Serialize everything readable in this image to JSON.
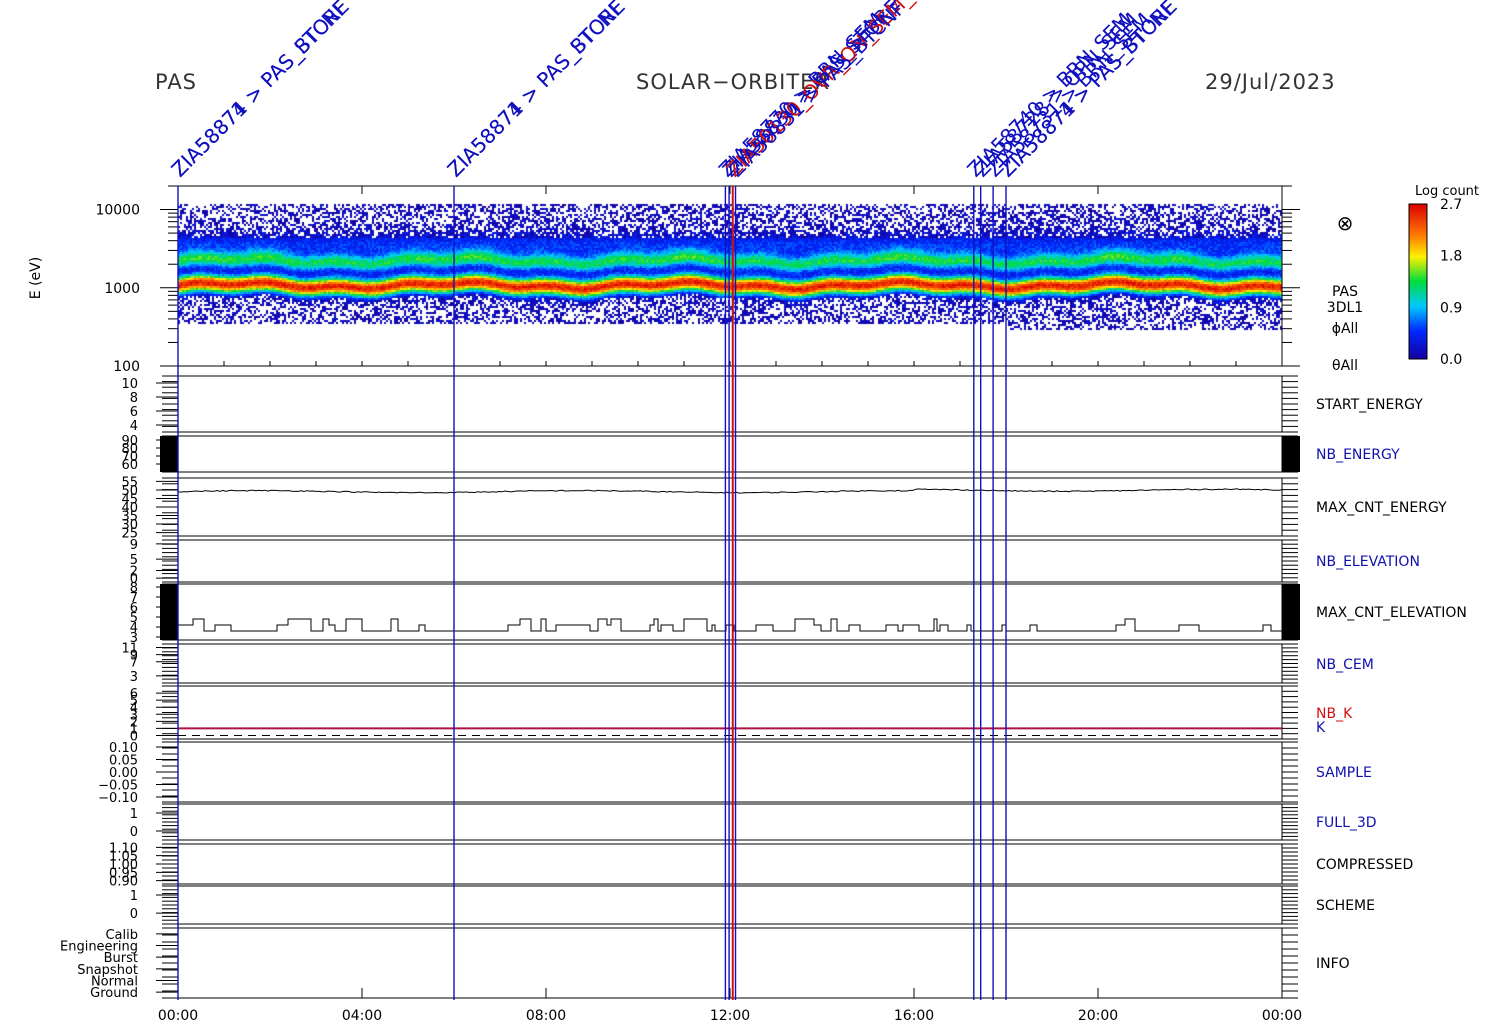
{
  "header": {
    "left": "PAS",
    "center": "SOLAR−ORBITER",
    "right": "29/Jul/2023"
  },
  "chart_data": {
    "type": "heatmap",
    "title": "",
    "x_ticks": [
      "00:00",
      "04:00",
      "08:00",
      "12:00",
      "16:00",
      "20:00",
      "00:00"
    ],
    "x_hours": [
      0,
      4,
      8,
      12,
      16,
      20,
      24
    ],
    "spectrogram": {
      "ylabel": "E (eV)",
      "y_scale": "log",
      "ylim": [
        100,
        20000
      ],
      "y_ticks": [
        10000,
        1000,
        100
      ],
      "y_tick_labels": [
        "10000",
        "1000",
        "100"
      ],
      "peak_energy_ev": 1100,
      "side_labels": [
        "PAS",
        "3DL1",
        "ϕAll",
        "θAll"
      ],
      "symbol": "⊗",
      "colorbar": {
        "label": "Log count",
        "range": [
          0.0,
          2.7
        ],
        "ticks": [
          "2.7",
          "1.8",
          "0.9",
          "0.0"
        ]
      }
    },
    "panels": [
      {
        "label": "START_ENERGY",
        "label_color": "#000000",
        "ylim": [
          3,
          11
        ],
        "ticks": [
          {
            "v": 10,
            "t": "10"
          },
          {
            "v": 8,
            "t": "8"
          },
          {
            "v": 6,
            "t": "6"
          },
          {
            "v": 4,
            "t": "4"
          }
        ]
      },
      {
        "label": "NB_ENERGY",
        "label_color": "#1010b0",
        "ylim": [
          50,
          95
        ],
        "ticks": [
          {
            "v": 90,
            "t": "90"
          },
          {
            "v": 80,
            "t": "80"
          },
          {
            "v": 70,
            "t": "70"
          },
          {
            "v": 60,
            "t": "60"
          }
        ]
      },
      {
        "label": "MAX_CNT_ENERGY",
        "label_color": "#000000",
        "ylim": [
          23,
          57
        ],
        "ticks": [
          {
            "v": 55,
            "t": "55"
          },
          {
            "v": 50,
            "t": "50"
          },
          {
            "v": 45,
            "t": "45"
          },
          {
            "v": 40,
            "t": "40"
          },
          {
            "v": 35,
            "t": "35"
          },
          {
            "v": 30,
            "t": "30"
          },
          {
            "v": 25,
            "t": "25"
          }
        ],
        "series_value": 49
      },
      {
        "label": "NB_ELEVATION",
        "label_color": "#1010b0",
        "ylim": [
          -1,
          10
        ],
        "ticks": [
          {
            "v": 9,
            "t": "9"
          },
          {
            "v": 5,
            "t": "5"
          },
          {
            "v": 2,
            "t": "2"
          },
          {
            "v": 0,
            "t": "0"
          }
        ]
      },
      {
        "label": "MAX_CNT_ELEVATION",
        "label_color": "#000000",
        "ylim": [
          2.7,
          8.3
        ],
        "ticks": [
          {
            "v": 8,
            "t": "8"
          },
          {
            "v": 7,
            "t": "7"
          },
          {
            "v": 6,
            "t": "6"
          },
          {
            "v": 5,
            "t": "5"
          },
          {
            "v": 4,
            "t": "4"
          },
          {
            "v": 3,
            "t": "3"
          }
        ]
      },
      {
        "label": "NB_CEM",
        "label_color": "#1010b0",
        "ylim": [
          1,
          12
        ],
        "ticks": [
          {
            "v": 11,
            "t": "11"
          },
          {
            "v": 9,
            "t": "9"
          },
          {
            "v": 7,
            "t": "7"
          },
          {
            "v": 3,
            "t": "3"
          }
        ]
      },
      {
        "label": "NB_K",
        "label_color": "#d01010",
        "second_label": "K",
        "second_color": "#1010b0",
        "ylim": [
          -0.5,
          7
        ],
        "ticks": [
          {
            "v": 6,
            "t": "6"
          },
          {
            "v": 5,
            "t": "5"
          },
          {
            "v": 4,
            "t": "4"
          },
          {
            "v": 3,
            "t": "3"
          },
          {
            "v": 2,
            "t": "2"
          },
          {
            "v": 1,
            "t": "1"
          },
          {
            "v": 0,
            "t": "0"
          }
        ],
        "nbk_value": 1,
        "k_value": 0
      },
      {
        "label": "SAMPLE",
        "label_color": "#1010b0",
        "ylim": [
          -0.12,
          0.12
        ],
        "ticks": [
          {
            "v": 0.1,
            "t": "0.10"
          },
          {
            "v": 0.05,
            "t": "0.05"
          },
          {
            "v": 0.0,
            "t": "0.00"
          },
          {
            "v": -0.05,
            "t": "−0.05"
          },
          {
            "v": -0.1,
            "t": "−0.10"
          }
        ]
      },
      {
        "label": "FULL_3D",
        "label_color": "#1010b0",
        "ylim": [
          -0.5,
          1.5
        ],
        "ticks": [
          {
            "v": 1,
            "t": "1"
          },
          {
            "v": 0,
            "t": "0"
          }
        ]
      },
      {
        "label": "COMPRESSED",
        "label_color": "#000000",
        "ylim": [
          0.88,
          1.12
        ],
        "ticks": [
          {
            "v": 1.1,
            "t": "1.10"
          },
          {
            "v": 1.05,
            "t": "1.05"
          },
          {
            "v": 1.0,
            "t": "1.00"
          },
          {
            "v": 0.95,
            "t": "0.95"
          },
          {
            "v": 0.9,
            "t": "0.90"
          }
        ]
      },
      {
        "label": "SCHEME",
        "label_color": "#000000",
        "ylim": [
          -0.6,
          1.5
        ],
        "ticks": [
          {
            "v": 1,
            "t": "1"
          },
          {
            "v": 0,
            "t": "0"
          }
        ]
      },
      {
        "label": "INFO",
        "label_color": "#000000",
        "ylim": [
          -0.5,
          5.5
        ],
        "ticks": [
          {
            "v": 5,
            "t": "Calib"
          },
          {
            "v": 4,
            "t": "Engineering"
          },
          {
            "v": 3,
            "t": "Burst"
          },
          {
            "v": 2,
            "t": "Snapshot"
          },
          {
            "v": 1,
            "t": "Normal"
          },
          {
            "v": 0,
            "t": "Ground"
          }
        ]
      }
    ],
    "events": [
      {
        "hour": 0.0,
        "color": "#1010c0",
        "label": "ZIA58874 > PAS_STORE"
      },
      {
        "hour": 0.0,
        "color": "#1010c0",
        "label": "ZIA58871 > PAS_BTCNF"
      },
      {
        "hour": 6.0,
        "color": "#1010c0",
        "label": "ZIA58874 > PAS_STORE"
      },
      {
        "hour": 6.0,
        "color": "#1010c0",
        "label": "ZIA58871 > PAS_BTCNF"
      },
      {
        "hour": 11.9,
        "color": "#1010c0",
        "label": "ZIA58770 > BRN_SEM"
      },
      {
        "hour": 11.98,
        "color": "#1010c0",
        "label": "ZIA58830 > PAS_STORE"
      },
      {
        "hour": 12.06,
        "color": "#d01010",
        "label": "ZIA50130_OVR_ON_SEM_NOM"
      },
      {
        "hour": 12.12,
        "color": "#1010c0",
        "label": "ZIA58831 > PAS_BTCNF"
      },
      {
        "hour": 17.3,
        "color": "#1010c0",
        "label": "ZIA58740 > BRN_SEM"
      },
      {
        "hour": 17.45,
        "color": "#1010c0",
        "label": "ZIA58728 > OPN_SEM"
      },
      {
        "hour": 17.72,
        "color": "#1010c0",
        "label": "ZIA58731 > BRN_SEM"
      },
      {
        "hour": 18.0,
        "color": "#1010c0",
        "label": "ZIA58874 > PAS_STORE"
      },
      {
        "hour": 18.0,
        "color": "#1010c0",
        "label": "ZIA58871 > PAS_BTCNF"
      }
    ]
  }
}
